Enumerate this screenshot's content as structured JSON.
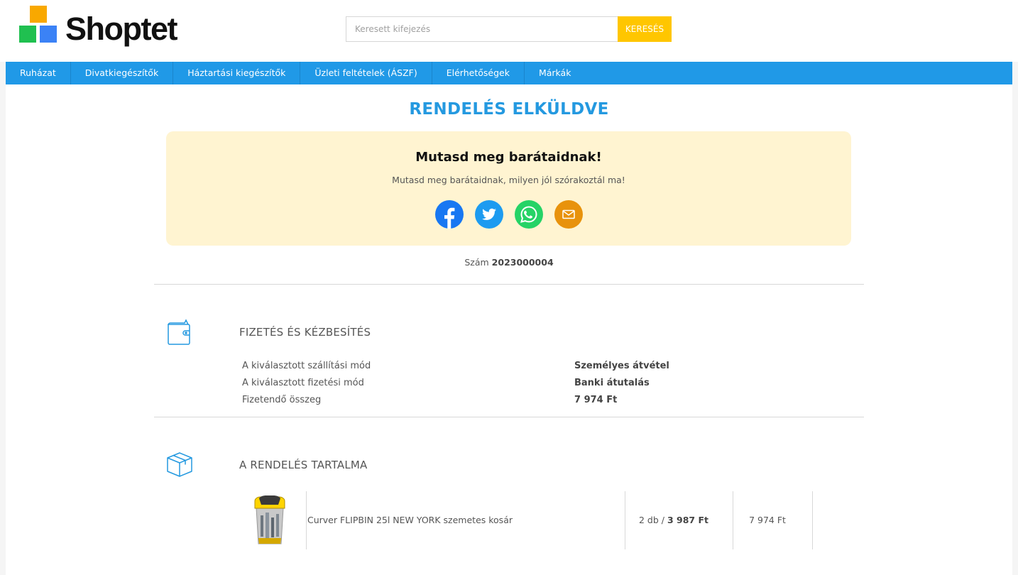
{
  "brand": {
    "name": "Shoptet"
  },
  "search": {
    "placeholder": "Keresett kifejezés",
    "button_label": "KERESÉS"
  },
  "nav": {
    "items": [
      {
        "label": "Ruházat"
      },
      {
        "label": "Divatkiegészítők"
      },
      {
        "label": "Háztartási kiegészítők"
      },
      {
        "label": "Üzleti feltételek (ÁSZF)"
      },
      {
        "label": "Elérhetőségek"
      },
      {
        "label": "Márkák"
      }
    ]
  },
  "page": {
    "title": "RENDELÉS ELKÜLDVE"
  },
  "share": {
    "title": "Mutasd meg barátaidnak!",
    "subtitle": "Mutasd meg barátaidnak, milyen jól szórakoztál ma!",
    "icons": [
      "facebook-icon",
      "twitter-icon",
      "whatsapp-icon",
      "email-icon"
    ],
    "colors": {
      "facebook": "#1877f2",
      "twitter": "#1d9bf0",
      "whatsapp": "#25d366",
      "email": "#e8920c",
      "box_bg": "#fff4d1"
    }
  },
  "order": {
    "number_label": "Szám",
    "number": "2023000004"
  },
  "payment_section": {
    "title": "FIZETÉS ÉS KÉZBESÍTÉS",
    "icon": "wallet-icon",
    "rows": [
      {
        "label": "A kiválasztott szállítási mód",
        "value": "Személyes átvétel"
      },
      {
        "label": "A kiválasztott fizetési mód",
        "value": "Banki átutalás"
      },
      {
        "label": "Fizetendő összeg",
        "value": "7 974 Ft"
      }
    ]
  },
  "content_section": {
    "title": "A RENDELÉS TARTALMA",
    "icon": "box-icon",
    "items": [
      {
        "name": "Curver FLIPBIN 25l NEW YORK szemetes kosár",
        "qty": "2 db",
        "unit_price": "3 987 Ft",
        "total": "7 974 Ft"
      }
    ]
  },
  "colors": {
    "accent": "#2099e7",
    "title": "#2499e0",
    "search_button": "#ffc600"
  }
}
